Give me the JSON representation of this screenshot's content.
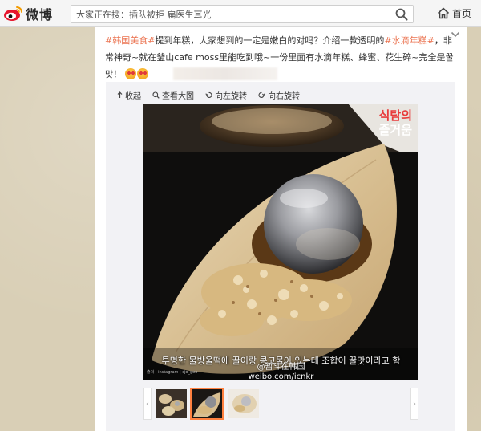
{
  "header": {
    "logo_text": "微博",
    "search_placeholder": "大家正在搜：插队被拒 扁医生耳光",
    "home_label": "首页"
  },
  "post": {
    "tag1": "#韩国美食#",
    "text1": "提到年糕，大家想到的一定是嫩白的对吗？介绍一款透明的",
    "tag2": "#水滴年糕#",
    "text2": "，非常神奇~就在釜山cafe moss里能吃到哦~一份里面有水滴年糕、蜂蜜、花生碎~完全是꿀맛！"
  },
  "toolbar": {
    "collapse": "收起",
    "view_large": "查看大图",
    "rotate_left": "向左旋转",
    "rotate_right": "向右旋转"
  },
  "photo": {
    "watermark_line1": "식탐의",
    "watermark_line2": "즐거움",
    "caption": "투명한 물방울떡에 꿀이랑 콩고물이 있는데 조합이 꿀맛이라고 함",
    "weibo_credit": "@暂斗在韩国",
    "weibo_url": "weibo.com/icnkr",
    "small_credit": "출처 | instagram | cjo_goo"
  },
  "colors": {
    "hashtag": "#eb7350",
    "thumb_active_border": "#ff8140"
  }
}
